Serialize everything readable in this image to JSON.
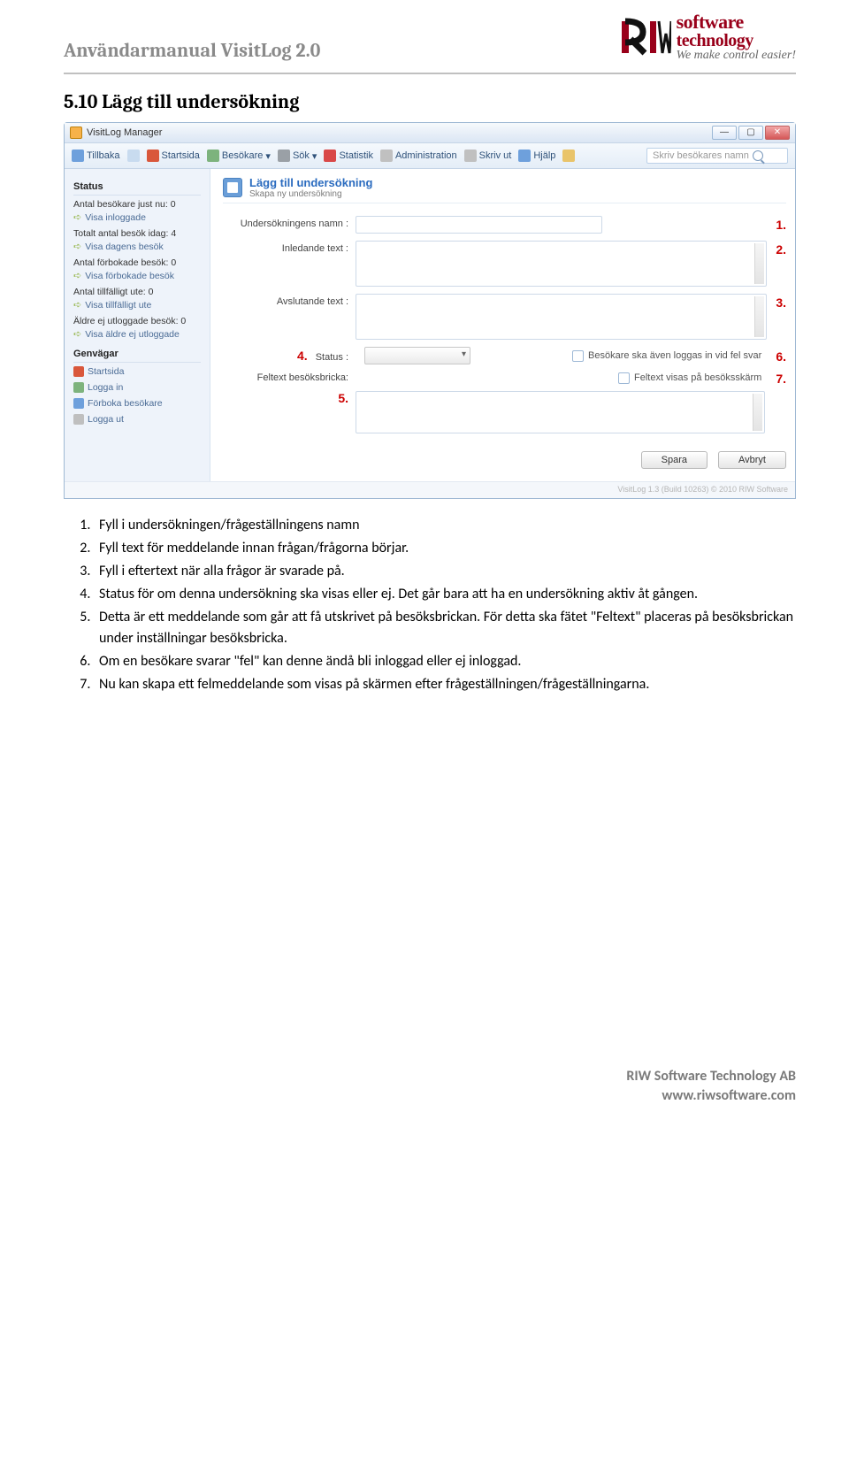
{
  "header": {
    "doc_title": "Användarmanual VisitLog 2.0",
    "logo_line1": "software",
    "logo_line2": "technology",
    "logo_tagline": "We make control easier!"
  },
  "section_title": "5.10 Lägg till undersökning",
  "app": {
    "window_title": "VisitLog Manager",
    "toolbar": {
      "back": "Tillbaka",
      "home": "Startsida",
      "visitors": "Besökare",
      "search": "Sök",
      "stats": "Statistik",
      "admin": "Administration",
      "print": "Skriv ut",
      "help": "Hjälp",
      "search_placeholder": "Skriv besökares namn"
    },
    "sidebar": {
      "status_head": "Status",
      "now_label": "Antal besökare just nu: 0",
      "now_link": "Visa inloggade",
      "today_label": "Totalt antal besök idag: 4",
      "today_link": "Visa dagens besök",
      "prebook_label": "Antal förbokade besök: 0",
      "prebook_link": "Visa förbokade besök",
      "temp_label": "Antal tillfälligt ute: 0",
      "temp_link": "Visa tillfälligt ute",
      "old_label": "Äldre ej utloggade besök: 0",
      "old_link": "Visa äldre ej utloggade",
      "shortcuts_head": "Genvägar",
      "sc_home": "Startsida",
      "sc_login": "Logga in",
      "sc_prebook": "Förboka besökare",
      "sc_logout": "Logga ut"
    },
    "main": {
      "title": "Lägg till undersökning",
      "subtitle": "Skapa ny undersökning",
      "lbl_name": "Undersökningens namn :",
      "lbl_intro": "Inledande text :",
      "lbl_outro": "Avslutande text :",
      "lbl_status": "Status :",
      "lbl_feltext": "Feltext besöksbricka:",
      "chk_login": "Besökare ska även loggas in vid fel svar",
      "chk_screen": "Feltext visas på besöksskärm",
      "btn_save": "Spara",
      "btn_cancel": "Avbryt",
      "statusbar": "VisitLog 1.3 (Build 10263)   © 2010 RIW Software"
    },
    "callouts": {
      "n1": "1.",
      "n2": "2.",
      "n3": "3.",
      "n4": "4.",
      "n5": "5.",
      "n6": "6.",
      "n7": "7."
    }
  },
  "instructions": [
    "Fyll i undersökningen/frågeställningens namn",
    "Fyll text för meddelande innan frågan/frågorna börjar.",
    "Fyll i eftertext när alla frågor är svarade på.",
    "Status för om denna undersökning ska visas eller ej. Det går bara att ha en undersökning aktiv åt gången.",
    "Detta är ett meddelande som går att få utskrivet på besöksbrickan. För detta ska fätet \"Feltext\" placeras på besöksbrickan under inställningar besöksbricka.",
    "Om en besökare svarar \"fel\" kan denne ändå bli inloggad eller ej inloggad.",
    "Nu kan skapa ett felmeddelande som visas på skärmen efter frågeställningen/frågeställningarna."
  ],
  "footer": {
    "company": "RIW Software Technology AB",
    "url": "www.riwsoftware.com"
  }
}
